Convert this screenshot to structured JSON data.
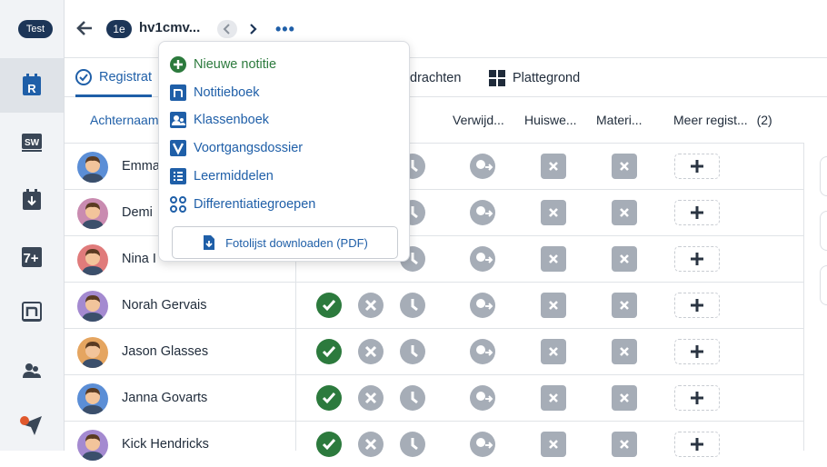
{
  "sidebar": {
    "env_badge": "Test",
    "items": [
      {
        "icon": "registration-r-icon",
        "label": "R",
        "active": true
      },
      {
        "icon": "sw-icon",
        "label": "SW"
      },
      {
        "icon": "calendar-download-icon"
      },
      {
        "icon": "seven-plus-icon",
        "label": "7+"
      },
      {
        "icon": "notebook-n-icon",
        "label": "n"
      },
      {
        "icon": "student-group-icon"
      },
      {
        "icon": "send-paperplane-icon"
      }
    ]
  },
  "topbar": {
    "group_badge": "1e",
    "group_name": "hv1cmv...",
    "more_label": "•••"
  },
  "tabs": [
    {
      "label": "Registrat",
      "icon": "check-circle-icon",
      "active": true
    },
    {
      "label": "drachten"
    },
    {
      "label": "Plattegrond",
      "icon": "grid-icon"
    }
  ],
  "columns": {
    "name": "Achternaam",
    "c1": "Verwijd...",
    "c2": "Huiswe...",
    "c3": "Materi...",
    "c4": "Meer regist...",
    "c4_count": "(2)"
  },
  "students": [
    {
      "name": "Emma",
      "avatar": "avatar-blue",
      "present": false
    },
    {
      "name": "Demi",
      "avatar": "avatar-pink",
      "present": false
    },
    {
      "name": "Nina I",
      "avatar": "avatar-red",
      "present": false
    },
    {
      "name": "Norah Gervais",
      "avatar": "avatar-purple",
      "present": true
    },
    {
      "name": "Jason Glasses",
      "avatar": "avatar-orange",
      "present": true
    },
    {
      "name": "Janna Govarts",
      "avatar": "avatar-blue",
      "present": true
    },
    {
      "name": "Kick Hendricks",
      "avatar": "avatar-purple",
      "present": true
    }
  ],
  "dropdown": {
    "items": [
      {
        "label": "Nieuwe notitie",
        "icon": "plus-circle-icon",
        "color": "green"
      },
      {
        "label": "Notitieboek",
        "icon": "notebook-icon"
      },
      {
        "label": "Klassenboek",
        "icon": "classbook-icon"
      },
      {
        "label": "Voortgangsdossier",
        "icon": "progress-file-icon"
      },
      {
        "label": "Leermiddelen",
        "icon": "list-icon"
      },
      {
        "label": "Differentiatiegroepen",
        "icon": "groups-icon"
      }
    ],
    "button": "Fotolijst downloaden (PDF)"
  },
  "colors": {
    "navy": "#1c3557",
    "blue": "#1f5fa8",
    "green": "#2c7a3d",
    "grey_icon": "#a6adb7"
  }
}
